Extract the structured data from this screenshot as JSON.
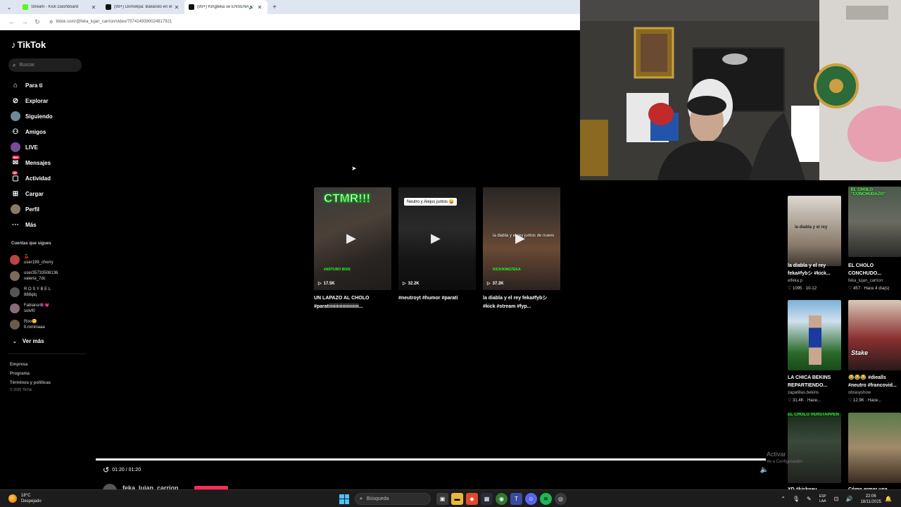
{
  "browser": {
    "tabs": [
      {
        "title": "Stream - Kick Dashboard",
        "active": false,
        "favicon_color": "#53fc18"
      },
      {
        "title": "(99+) Domelipa: Bailando en el",
        "active": false,
        "favicon_color": "#111111"
      },
      {
        "title": "(99+) Kingteka se ENSEÑA",
        "active": true,
        "favicon_color": "#111111"
      }
    ],
    "url": "tiktok.com/@feka_lujan_carrion/video/7574149390024817921"
  },
  "tiktok": {
    "logo": "TikTok",
    "search_placeholder": "Buscar",
    "nav": [
      {
        "label": "Para ti",
        "icon": "home-icon"
      },
      {
        "label": "Explorar",
        "icon": "compass-icon"
      },
      {
        "label": "Siguiendo",
        "icon": "following-avatar-icon"
      },
      {
        "label": "Amigos",
        "icon": "friends-icon"
      },
      {
        "label": "LIVE",
        "icon": "live-icon"
      },
      {
        "label": "Mensajes",
        "icon": "messages-icon",
        "badge": "99+"
      },
      {
        "label": "Actividad",
        "icon": "activity-icon",
        "badge": "99"
      },
      {
        "label": "Cargar",
        "icon": "upload-icon"
      },
      {
        "label": "Perfil",
        "icon": "profile-avatar-icon"
      },
      {
        "label": "Más",
        "icon": "more-icon"
      }
    ],
    "following_title": "Cuentas que sigues",
    "following": [
      {
        "line1": "🍒",
        "line2": "user199_cherry",
        "color": "#b44"
      },
      {
        "line1": "user35733508136",
        "line2": "valeria_7dc",
        "color": "#7a6a5a"
      },
      {
        "line1": "R O S Y B E L",
        "line2": "888qlq",
        "color": "#555"
      },
      {
        "line1": "Fabiana👾💗",
        "line2": "solvf0",
        "color": "#8a6a7a"
      },
      {
        "line1": "Roo🙂",
        "line2": "lt.rominaaa",
        "color": "#6a5a4a"
      }
    ],
    "ver_mas": "Ver más",
    "footer": [
      "Empresa",
      "Programa",
      "Términos y políticas"
    ],
    "copyright": "© 2025 TikTok"
  },
  "related": [
    {
      "views": "17.5K",
      "caption": "UN LAPAZO AL CHOLO",
      "caption2": "#parati﻿iiiiiiiiiiiiiiiiiiiii...",
      "overlay": "CTMR!!!",
      "green": "#ARTURO BOIS"
    },
    {
      "views": "32.2K",
      "caption": "#neutroyt #humor #parati",
      "caption2": "",
      "overlay": "Neutro y Alejus juntos 😛"
    },
    {
      "views": "37.2K",
      "caption": "la diabla y el rey feka#fybシ",
      "caption2": "#kick #stream #fyp...",
      "overlay": "la diabla y el rey juntos de nuevo",
      "green": "KICK/KINGTEKA"
    }
  ],
  "player": {
    "time": "01:20 / 01:20",
    "author": "feka_lujan_carrion"
  },
  "recommendations": [
    {
      "title": "la diabla y el rey",
      "title2": "feka#fybシ #kick...",
      "author": "elfeka.p",
      "meta": "♡ 1095 · 10-12",
      "ov": "la diabla y el rey"
    },
    {
      "title": "EL CHOLO",
      "title2": "CONCHUDO...",
      "author": "feka_lujan_carrion",
      "meta": "♡ 457 · Hace 4 día(s)",
      "ov": "EL CHOLO \"CONCHUDAZO\""
    },
    {
      "title": "LA CHICA BEKINS",
      "title2": "REPARTIENDO...",
      "author": "zapatillas.bekins",
      "meta": "♡ 31.4K · Hace...",
      "ov": ""
    },
    {
      "title": "😂😂😂 #diealls",
      "title2": "#neutro #francovid...",
      "author": "obrasyshow",
      "meta": "♡ 12.9K · Hace...",
      "ov": "Stake"
    },
    {
      "title": "XD #kickneu...",
      "title2": "",
      "author": "",
      "meta": "",
      "ov": "EL CHOLO VERSTAPPEN"
    },
    {
      "title": "Cómo armar una...",
      "title2": "",
      "author": "",
      "meta": "",
      "ov": ""
    }
  ],
  "windows_activation": {
    "line1": "Activar",
    "line2": "Ve a Configuración"
  },
  "taskbar": {
    "temp": "18°C",
    "weather": "Despejado",
    "search": "Búsqueda",
    "lang1": "ESP",
    "lang2": "LAA",
    "time": "22:06",
    "date": "18/11/2025"
  }
}
